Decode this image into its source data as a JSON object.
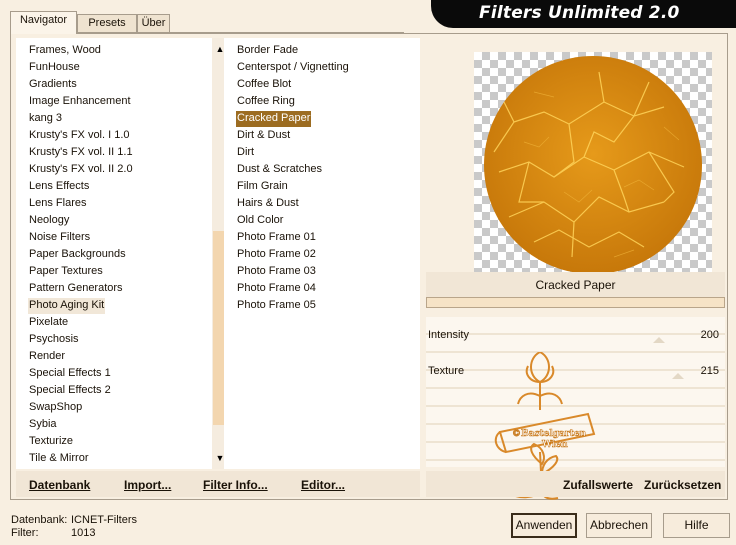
{
  "tabs": [
    "Navigator",
    "Presets",
    "Über"
  ],
  "app_title": "Filters Unlimited 2.0",
  "categories": [
    "Frames, Wood",
    "FunHouse",
    "Gradients",
    "Image Enhancement",
    "kang 3",
    "Krusty's FX vol. I 1.0",
    "Krusty's FX vol. II 1.1",
    "Krusty's FX vol. II 2.0",
    "Lens Effects",
    "Lens Flares",
    "Neology",
    "Noise Filters",
    "Paper Backgrounds",
    "Paper Textures",
    "Pattern Generators",
    "Photo Aging Kit",
    "Pixelate",
    "Psychosis",
    "Render",
    "Special Effects 1",
    "Special Effects 2",
    "SwapShop",
    "Sybia",
    "Texturize",
    "Tile & Mirror"
  ],
  "selected_category": "Photo Aging Kit",
  "filters": [
    "Border Fade",
    "Centerspot / Vignetting",
    "Coffee Blot",
    "Coffee Ring",
    "Cracked Paper",
    "Dirt & Dust",
    "Dirt",
    "Dust & Scratches",
    "Film Grain",
    "Hairs & Dust",
    "Old Color",
    "Photo Frame 01",
    "Photo Frame 02",
    "Photo Frame 03",
    "Photo Frame 04",
    "Photo Frame 05"
  ],
  "selected_filter": "Cracked Paper",
  "preview": {
    "filter_name": "Cracked Paper"
  },
  "params": [
    {
      "label": "Intensity",
      "value": "200"
    },
    {
      "label": "Texture",
      "value": "215"
    }
  ],
  "stamp_text": {
    "line1": "©Bastelgarten",
    "line2": "Wien"
  },
  "left_buttons": [
    "Datenbank",
    "Import...",
    "Filter Info...",
    "Editor..."
  ],
  "right_buttons": [
    "Zufallswerte",
    "Zurücksetzen"
  ],
  "footer": {
    "database_label": "Datenbank:",
    "database_value": "ICNET-Filters",
    "filter_label": "Filter:",
    "filter_value": "1013"
  },
  "dialog_buttons": [
    "Anwenden",
    "Abbrechen",
    "Hilfe"
  ],
  "colors": {
    "accent": "#9c6c21",
    "selection_soft": "#f1e7d8",
    "preview_disc": "#d8870f",
    "brand_bg": "#0a0a0a"
  }
}
